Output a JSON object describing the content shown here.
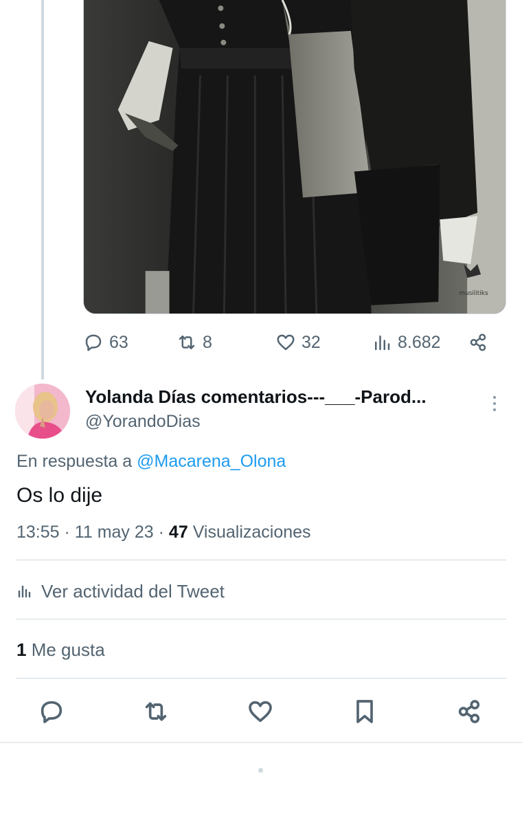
{
  "parent_tweet": {
    "media": {
      "watermark": "musilitiks"
    },
    "stats": {
      "replies": "63",
      "retweets": "8",
      "likes": "32",
      "views": "8.682"
    }
  },
  "reply": {
    "author": {
      "display_name": "Yolanda Días comentarios---___-Parod...",
      "handle": "@YorandoDias"
    },
    "in_reply_prefix": "En respuesta a",
    "in_reply_mention": "@Macarena_Olona",
    "text": "Os lo dije",
    "time": "13:55",
    "date": "11 may 23",
    "views_count": "47",
    "views_label": "Visualizaciones",
    "activity_label": "Ver actividad del Tweet",
    "likes_count": "1",
    "likes_label": "Me gusta"
  },
  "icons": {
    "top_actions": [
      "reply-icon",
      "retweet-icon",
      "like-icon",
      "views-icon",
      "share-icon"
    ],
    "bottom_actions": [
      "reply-icon",
      "retweet-icon",
      "like-icon",
      "bookmark-icon",
      "share-icon"
    ]
  },
  "colors": {
    "link": "#1d9bf0",
    "secondary_text": "#536471",
    "divider": "#cfd9de"
  }
}
